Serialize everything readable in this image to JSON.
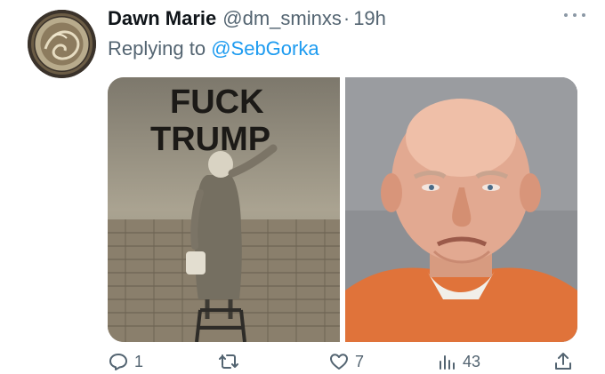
{
  "tweet": {
    "author_name": "Dawn Marie",
    "handle": "@dm_sminxs",
    "separator": "·",
    "time": "19h",
    "reply_prefix": "Replying to",
    "reply_to": "@SebGorka",
    "media": {
      "left_image": {
        "graffiti_text_line1": "FUCK",
        "graffiti_text_line2": "TRUMP"
      },
      "right_image": {}
    },
    "actions": {
      "reply_count": "1",
      "retweet_count": "",
      "like_count": "7",
      "views_count": "43"
    },
    "icons": [
      "more-icon",
      "reply-icon",
      "retweet-icon",
      "like-icon",
      "views-icon",
      "share-icon"
    ]
  },
  "colors": {
    "text_primary": "#0f1419",
    "text_secondary": "#536471",
    "link": "#1d9bf0"
  }
}
